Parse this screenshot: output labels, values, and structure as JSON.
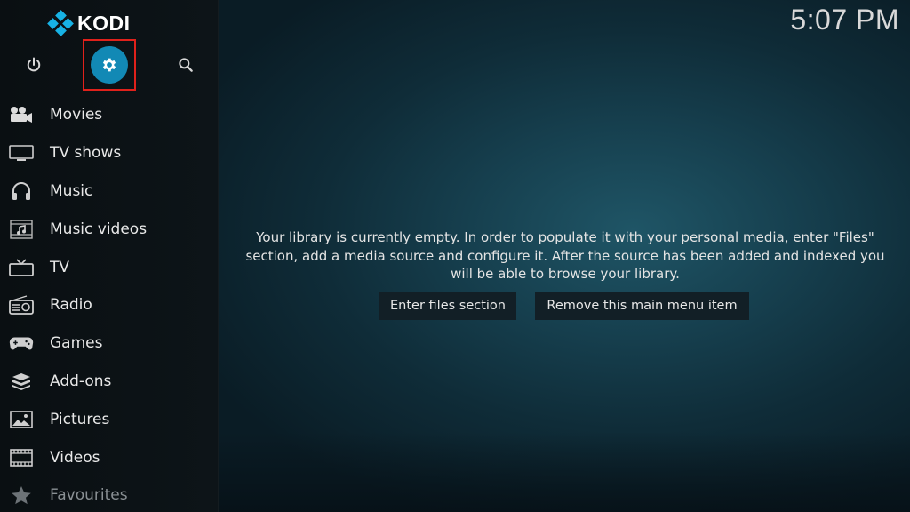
{
  "app": {
    "logo_text": "KODI"
  },
  "clock": {
    "time": "5:07 PM"
  },
  "top_icons": {
    "power": "power-icon",
    "settings": "gear-icon",
    "search": "search-icon"
  },
  "sidebar": {
    "items": [
      {
        "label": "Movies",
        "icon": "movie-camera-icon"
      },
      {
        "label": "TV shows",
        "icon": "tv-monitor-icon"
      },
      {
        "label": "Music",
        "icon": "headphones-icon"
      },
      {
        "label": "Music videos",
        "icon": "music-video-icon"
      },
      {
        "label": "TV",
        "icon": "tv-icon"
      },
      {
        "label": "Radio",
        "icon": "radio-icon"
      },
      {
        "label": "Games",
        "icon": "gamepad-icon"
      },
      {
        "label": "Add-ons",
        "icon": "addons-box-icon"
      },
      {
        "label": "Pictures",
        "icon": "picture-icon"
      },
      {
        "label": "Videos",
        "icon": "film-strip-icon"
      },
      {
        "label": "Favourites",
        "icon": "star-icon"
      }
    ]
  },
  "main": {
    "message": "Your library is currently empty. In order to populate it with your personal media, enter \"Files\" section, add a media source and configure it. After the source has been added and indexed you will be able to browse your library.",
    "buttons": {
      "enter_files": "Enter files section",
      "remove_item": "Remove this main menu item"
    }
  },
  "colors": {
    "accent": "#1289b5",
    "logo_blue": "#17b2e5",
    "highlight_border": "#e0211b"
  }
}
